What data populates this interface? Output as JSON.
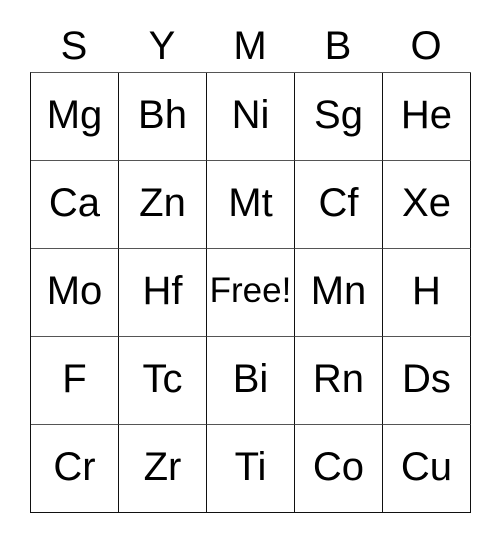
{
  "card": {
    "type": "bingo-card",
    "title_letters": [
      "S",
      "Y",
      "M",
      "B",
      "O"
    ],
    "columns": 5,
    "rows": 5,
    "free_space": {
      "row": 3,
      "column": 3,
      "label": "Free!"
    },
    "colors": {
      "background": "#ffffff",
      "text": "#000000",
      "grid_line": "#555555",
      "grid_line_dark": "#111111"
    },
    "header": {
      "letter_0": "S",
      "letter_1": "Y",
      "letter_2": "M",
      "letter_3": "B",
      "letter_4": "O"
    },
    "grid": [
      [
        "Mg",
        "Bh",
        "Ni",
        "Sg",
        "He"
      ],
      [
        "Ca",
        "Zn",
        "Mt",
        "Cf",
        "Xe"
      ],
      [
        "Mo",
        "Hf",
        "Free!",
        "Mn",
        "H"
      ],
      [
        "F",
        "Tc",
        "Bi",
        "Rn",
        "Ds"
      ],
      [
        "Cr",
        "Zr",
        "Ti",
        "Co",
        "Cu"
      ]
    ]
  }
}
